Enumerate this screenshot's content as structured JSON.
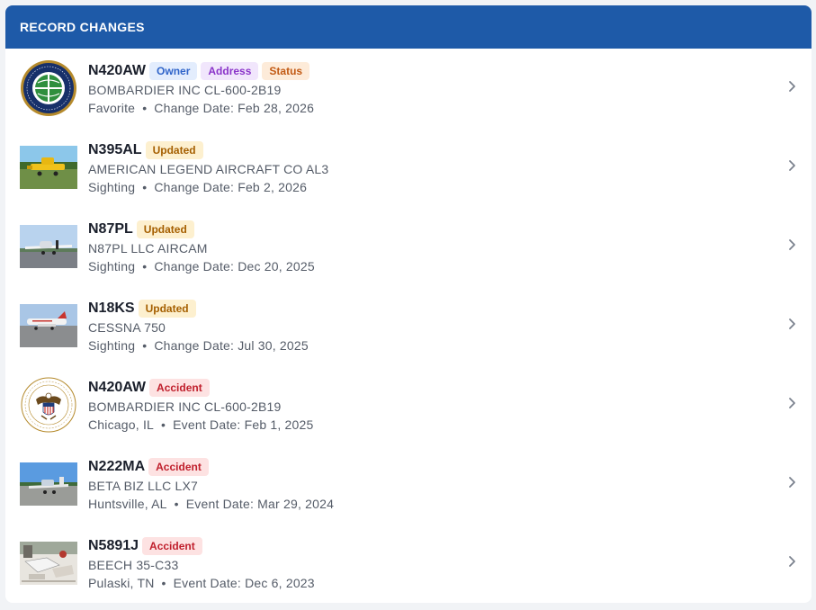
{
  "header": {
    "title": "RECORD CHANGES"
  },
  "records": [
    {
      "tail": "N420AW",
      "badges": [
        "Owner",
        "Address",
        "Status"
      ],
      "aircraft": "BOMBARDIER INC CL-600-2B19",
      "source": "Favorite",
      "date_label": "Change Date: Feb 28, 2026",
      "thumb": "faa-seal"
    },
    {
      "tail": "N395AL",
      "badges": [
        "Updated"
      ],
      "aircraft": "AMERICAN LEGEND AIRCRAFT CO AL3",
      "source": "Sighting",
      "date_label": "Change Date: Feb 2, 2026",
      "thumb": "yellow-plane-photo"
    },
    {
      "tail": "N87PL",
      "badges": [
        "Updated"
      ],
      "aircraft": "N87PL LLC AIRCAM",
      "source": "Sighting",
      "date_label": "Change Date: Dec 20, 2025",
      "thumb": "aircam-photo"
    },
    {
      "tail": "N18KS",
      "badges": [
        "Updated"
      ],
      "aircraft": "CESSNA 750",
      "source": "Sighting",
      "date_label": "Change Date: Jul 30, 2025",
      "thumb": "jet-ramp-photo"
    },
    {
      "tail": "N420AW",
      "badges": [
        "Accident"
      ],
      "aircraft": "BOMBARDIER INC CL-600-2B19",
      "source": "Chicago, IL",
      "date_label": "Event Date: Feb 1, 2025",
      "thumb": "ntsb-seal"
    },
    {
      "tail": "N222MA",
      "badges": [
        "Accident"
      ],
      "aircraft": "BETA BIZ LLC LX7",
      "source": "Huntsville, AL",
      "date_label": "Event Date: Mar 29, 2024",
      "thumb": "small-plane-photo"
    },
    {
      "tail": "N5891J",
      "badges": [
        "Accident"
      ],
      "aircraft": "BEECH 35-C33",
      "source": "Pulaski, TN",
      "date_label": "Event Date: Dec 6, 2023",
      "thumb": "wreckage-photo"
    }
  ],
  "seal_text": {
    "faa_top": "FEDERAL AVIATION",
    "faa_bottom": "ADMINISTRATION",
    "ntsb_top": "NATIONAL TRANSPORTATION",
    "ntsb_bottom": "SAFETY BOARD"
  },
  "colors": {
    "header_bg": "#1e5aa8",
    "owner": "#2f64c9",
    "address": "#8a34c9",
    "status": "#c25a14",
    "updated": "#a55f00",
    "accident": "#c01f2c"
  },
  "icons": {
    "row_chevron": "chevron-right-icon"
  }
}
